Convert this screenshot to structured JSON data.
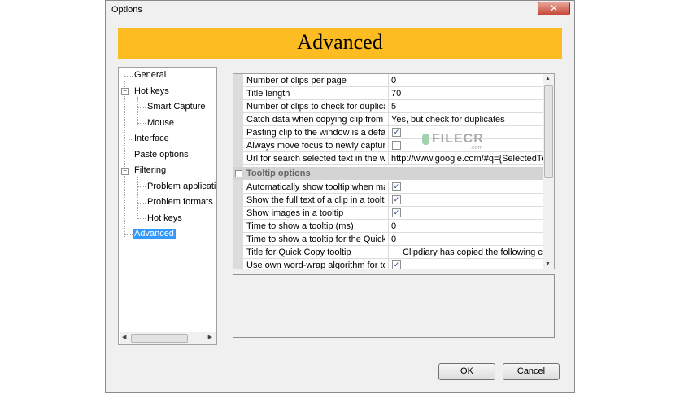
{
  "window": {
    "title": "Options"
  },
  "banner": {
    "title": "Advanced"
  },
  "tree": {
    "items": [
      {
        "label": "General"
      },
      {
        "label": "Hot keys"
      },
      {
        "label": "Smart Capture"
      },
      {
        "label": "Mouse"
      },
      {
        "label": "Interface"
      },
      {
        "label": "Paste options"
      },
      {
        "label": "Filtering"
      },
      {
        "label": "Problem applications"
      },
      {
        "label": "Problem formats"
      },
      {
        "label": "Hot keys"
      },
      {
        "label": "Advanced",
        "selected": true
      }
    ]
  },
  "properties": {
    "rows": [
      {
        "name": "Number of clips per page",
        "value": "0"
      },
      {
        "name": "Title length",
        "value": "70"
      },
      {
        "name": "Number of clips to check for duplicate",
        "value": "5"
      },
      {
        "name": "Catch data when copying clip from Clipdiary",
        "value": "Yes, but check for duplicates"
      },
      {
        "name": "Pasting clip to the window is a default action",
        "checked": true
      },
      {
        "name": "Always move focus to newly captured clip",
        "checked": false
      },
      {
        "name": "Url for search selected text in the web",
        "value": "http://www.google.com/#q={SelectedText}"
      }
    ],
    "category": "Tooltip options",
    "tooltip_rows": [
      {
        "name": "Automatically show tooltip when main window",
        "checked": true
      },
      {
        "name": "Show the full text of a clip in a tooltip",
        "checked": true
      },
      {
        "name": "Show images in a tooltip",
        "checked": true
      },
      {
        "name": "Time to show a tooltip (ms)",
        "value": "0"
      },
      {
        "name": "Time to show a tooltip for the Quick Copy",
        "value": "0"
      },
      {
        "name": "Title for Quick Copy tooltip",
        "value": "Clipdiary has copied the following clip"
      },
      {
        "name": "Use own word-wrap algorithm for tooltips",
        "checked": true
      }
    ]
  },
  "watermark": {
    "text": "FILECR",
    "suffix": ".com"
  },
  "buttons": {
    "ok": "OK",
    "cancel": "Cancel"
  },
  "icons": {
    "close": "close-icon",
    "check": "check-icon"
  }
}
